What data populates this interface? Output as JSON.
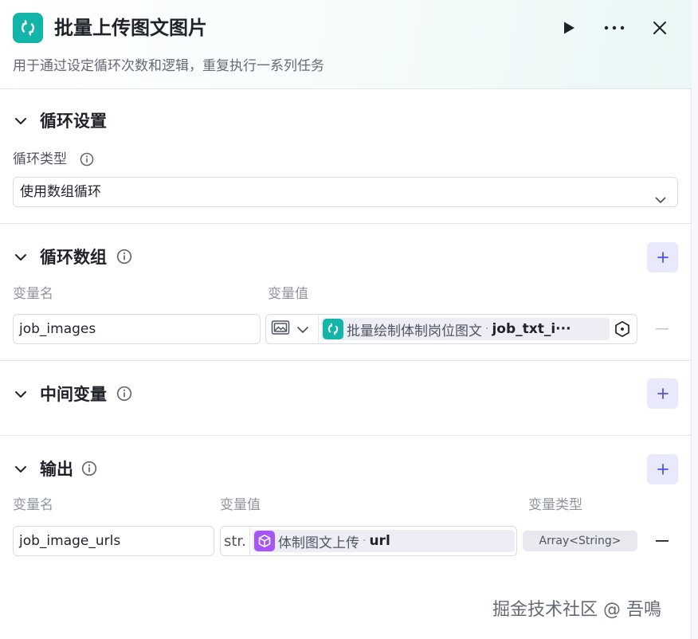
{
  "header": {
    "title": "批量上传图文图片",
    "subtitle": "用于通过设定循环次数和逻辑，重复执行一系列任务",
    "node_icon": "loop-icon",
    "run_icon": "play-icon",
    "more_icon": "more-icon",
    "close_icon": "close-icon",
    "accent_color": "#12b5a8"
  },
  "loop_settings": {
    "title": "循环设置",
    "type_label": "循环类型",
    "type_value": "使用数组循环"
  },
  "loop_array": {
    "title": "循环数组",
    "col_name": "变量名",
    "col_value": "变量值",
    "rows": [
      {
        "name": "job_images",
        "source_node": "批量绘制体制岗位图文",
        "separator": "·",
        "source_var": "job_txt_i···"
      }
    ]
  },
  "intermediate": {
    "title": "中间变量"
  },
  "output": {
    "title": "输出",
    "col_name": "变量名",
    "col_value": "变量值",
    "col_type": "变量类型",
    "rows": [
      {
        "name": "job_image_urls",
        "value_type_prefix": "str.",
        "source_node": "体制图文上传",
        "separator": "·",
        "source_var": "url",
        "var_type": "Array<String>"
      }
    ]
  },
  "watermark": "掘金技术社区 @ 吾鳴"
}
